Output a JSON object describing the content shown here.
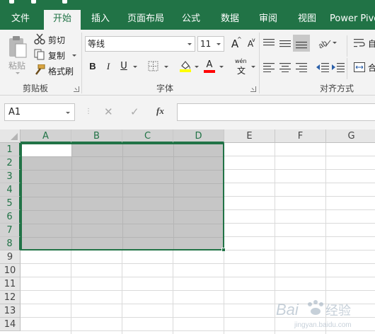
{
  "tabs": [
    {
      "label": "文件",
      "active": false
    },
    {
      "label": "开始",
      "active": true
    },
    {
      "label": "插入",
      "active": false
    },
    {
      "label": "页面布局",
      "active": false
    },
    {
      "label": "公式",
      "active": false
    },
    {
      "label": "数据",
      "active": false
    },
    {
      "label": "审阅",
      "active": false
    },
    {
      "label": "视图",
      "active": false
    },
    {
      "label": "Power Pivo",
      "active": false
    }
  ],
  "clipboard": {
    "paste_label": "粘贴",
    "cut_label": "剪切",
    "copy_label": "复制",
    "format_painter_label": "格式刷",
    "group_label": "剪贴板"
  },
  "font": {
    "font_name": "等线",
    "font_size": "11",
    "bold": "B",
    "italic": "I",
    "underline": "U",
    "grow": "A",
    "shrink": "A",
    "font_color": "A",
    "phonetic_top": "wén",
    "phonetic_bottom": "文",
    "group_label": "字体"
  },
  "alignment": {
    "group_label": "对齐方式",
    "wrap_label": "自",
    "merge_label": "合"
  },
  "formula_bar": {
    "name_box": "A1",
    "cancel_icon": "✕",
    "enter_icon": "✓",
    "fx_label": "fx",
    "formula_value": ""
  },
  "sheet": {
    "columns": [
      "A",
      "B",
      "C",
      "D",
      "E",
      "F",
      "G"
    ],
    "rows": [
      "1",
      "2",
      "3",
      "4",
      "5",
      "6",
      "7",
      "8",
      "9",
      "10",
      "11",
      "12",
      "13",
      "14"
    ],
    "selected_range": "A1:D8",
    "active_cell": "A1"
  },
  "colors": {
    "accent": "#217346",
    "selection_fill": "#c6c6c6",
    "header_bg": "#e6e6e6",
    "ribbon_bg": "#f3f3f3"
  },
  "watermark": {
    "text": "Baidu 经验",
    "sub": "jingyan.baidu.com"
  }
}
